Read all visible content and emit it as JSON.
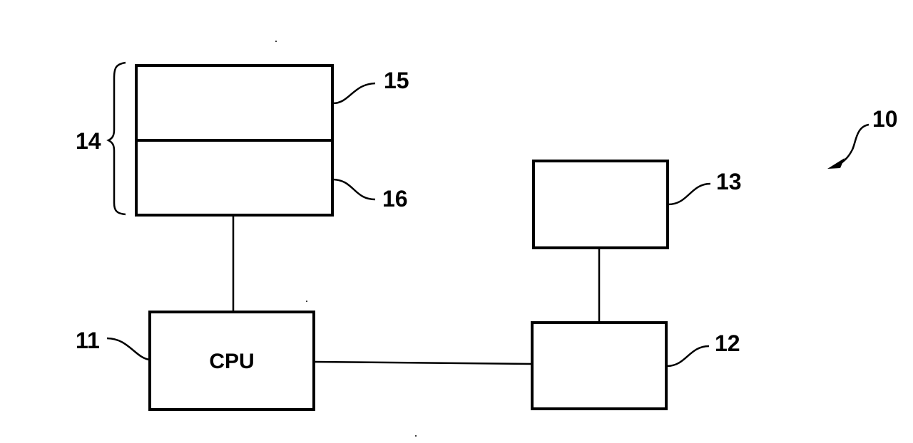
{
  "diagram": {
    "type": "block-diagram",
    "system_ref": "10",
    "blocks": {
      "cpu": {
        "ref": "11",
        "label": "CPU"
      },
      "block12": {
        "ref": "12",
        "label": ""
      },
      "block13": {
        "ref": "13",
        "label": ""
      },
      "memory_upper": {
        "ref": "15",
        "label": ""
      },
      "memory_lower": {
        "ref": "16",
        "label": ""
      }
    },
    "group": {
      "ref": "14",
      "members": [
        "15",
        "16"
      ]
    },
    "connections": [
      [
        "14",
        "11"
      ],
      [
        "11",
        "12"
      ],
      [
        "12",
        "13"
      ]
    ]
  }
}
